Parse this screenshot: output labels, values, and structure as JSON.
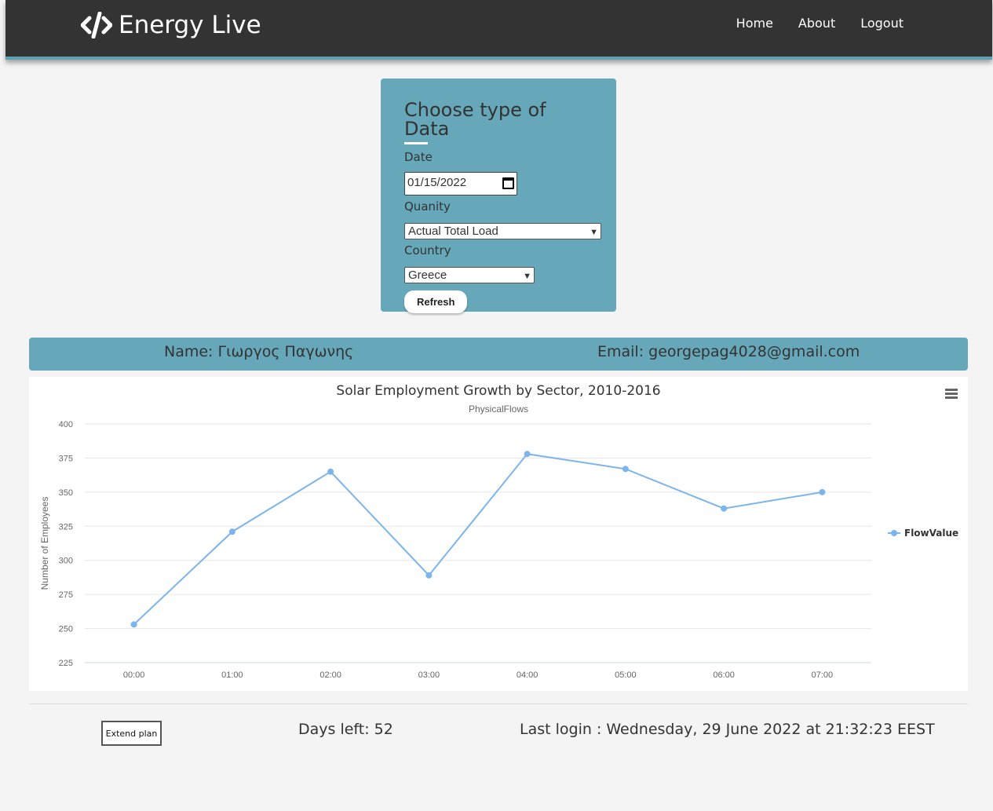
{
  "navbar": {
    "brand": "Energy Live",
    "links": [
      "Home",
      "About",
      "Logout"
    ]
  },
  "form": {
    "title": "Choose type of Data",
    "date_label": "Date",
    "date_value": "01/15/2022",
    "quantity_label": "Quanity",
    "quantity_value": "Actual Total Load",
    "country_label": "Country",
    "country_value": "Greece",
    "refresh_label": "Refresh"
  },
  "user": {
    "name": "Name: Γιωργος Παγωνης",
    "email": "Email: georgepag4028@gmail.com"
  },
  "chart_data": {
    "type": "line",
    "title": "Solar Employment Growth by Sector, 2010-2016",
    "subtitle": "PhysicalFlows",
    "ylabel": "Number of Employees",
    "xlabel": "",
    "categories": [
      "00:00",
      "01:00",
      "02:00",
      "03:00",
      "04:00",
      "05:00",
      "06:00",
      "07:00"
    ],
    "series": [
      {
        "name": "FlowValue",
        "values": [
          253,
          321,
          365,
          289,
          378,
          367,
          338,
          350
        ]
      }
    ],
    "ylim": [
      225,
      400
    ],
    "yticks": [
      225,
      250,
      275,
      300,
      325,
      350,
      375,
      400
    ],
    "grid": true,
    "legend": "right",
    "color": "#7cb5ec"
  },
  "footer": {
    "extend_label": "Extend plan",
    "days_left": "Days left: 52",
    "last_login": "Last login : Wednesday, 29 June 2022 at 21:32:23 EEST"
  }
}
